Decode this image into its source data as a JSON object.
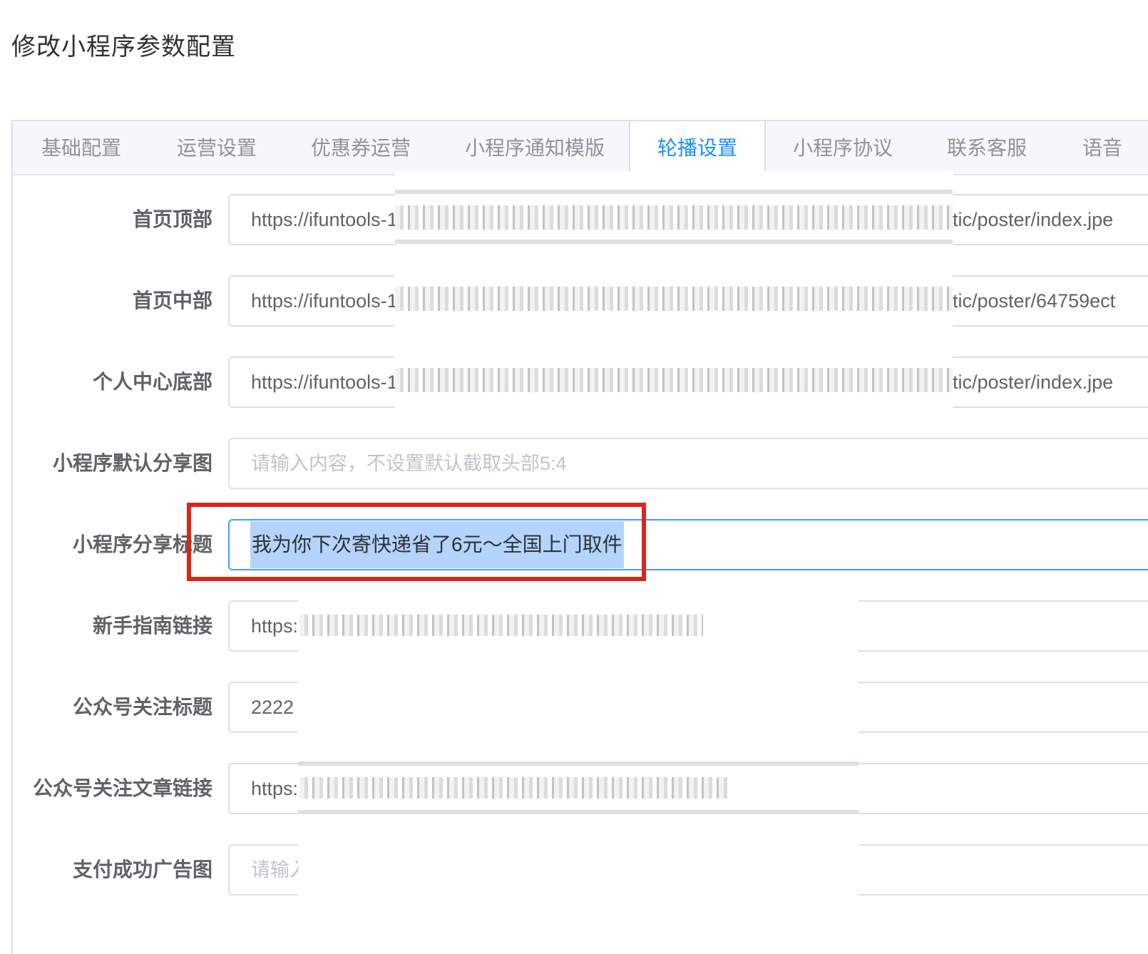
{
  "page": {
    "title": "修改小程序参数配置"
  },
  "tabs": [
    {
      "label": "基础配置"
    },
    {
      "label": "运营设置"
    },
    {
      "label": "优惠券运营"
    },
    {
      "label": "小程序通知模版"
    },
    {
      "label": "轮播设置",
      "active": true
    },
    {
      "label": "小程序协议"
    },
    {
      "label": "联系客服"
    },
    {
      "label": "语音"
    }
  ],
  "form": {
    "fields": [
      {
        "label": "首页顶部",
        "value": "https://ifuntools-1",
        "tail": "tic/poster/index.jpe"
      },
      {
        "label": "首页中部",
        "value": "https://ifuntools-1",
        "tail": "tic/poster/64759ect"
      },
      {
        "label": "个人中心底部",
        "value": "https://ifuntools-1",
        "tail": "tic/poster/index.jpe"
      },
      {
        "label": "小程序默认分享图",
        "value": "",
        "placeholder": "请输入内容，不设置默认截取头部5:4"
      },
      {
        "label": "小程序分享标题",
        "value": "我为你下次寄快递省了6元～全国上门取件"
      },
      {
        "label": "新手指南链接",
        "value": "https:"
      },
      {
        "label": "公众号关注标题",
        "value": "2222"
      },
      {
        "label": "公众号关注文章链接",
        "value": "https:"
      },
      {
        "label": "支付成功广告图",
        "value": "",
        "placeholder": "请输入内容"
      }
    ]
  },
  "colors": {
    "accent": "#1890ff",
    "highlight": "#d9261c",
    "selection": "#b3d4fc"
  }
}
